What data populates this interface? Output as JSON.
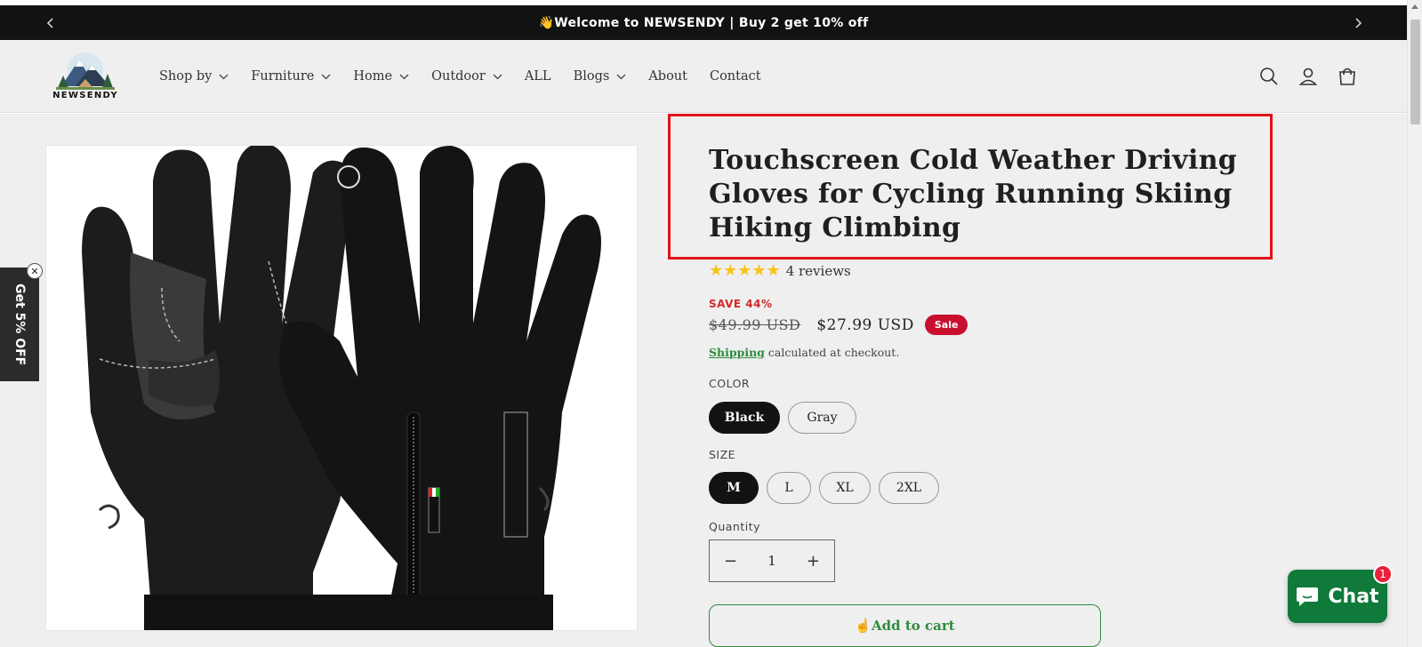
{
  "announcement": {
    "text": "👋Welcome to NEWSENDY |  Buy 2 get 10% off"
  },
  "header": {
    "brand": "NEWSENDY",
    "nav": [
      {
        "label": "Shop by",
        "dropdown": true
      },
      {
        "label": "Furniture",
        "dropdown": true
      },
      {
        "label": "Home",
        "dropdown": true
      },
      {
        "label": "Outdoor",
        "dropdown": true
      },
      {
        "label": "ALL",
        "dropdown": false
      },
      {
        "label": "Blogs",
        "dropdown": true
      },
      {
        "label": "About",
        "dropdown": false
      },
      {
        "label": "Contact",
        "dropdown": false
      }
    ],
    "icons": [
      "search-icon",
      "account-icon",
      "cart-icon"
    ]
  },
  "side_tab": {
    "label": "Get 5% OFF",
    "close": "✕"
  },
  "product": {
    "title": "Touchscreen Cold Weather Driving Gloves for Cycling Running Skiing Hiking Climbing",
    "rating_stars": 5,
    "reviews": "4 reviews",
    "save": "SAVE 44%",
    "price_old": "$49.99 USD",
    "price_new": "$27.99 USD",
    "sale_badge": "Sale",
    "shipping_link": "Shipping",
    "shipping_text": " calculated at checkout.",
    "color_label": "COLOR",
    "colors": [
      {
        "label": "Black",
        "selected": true
      },
      {
        "label": "Gray",
        "selected": false
      }
    ],
    "size_label": "SIZE",
    "sizes": [
      {
        "label": "M",
        "selected": true
      },
      {
        "label": "L",
        "selected": false
      },
      {
        "label": "XL",
        "selected": false
      },
      {
        "label": "2XL",
        "selected": false
      }
    ],
    "quantity_label": "Quantity",
    "quantity_value": "1",
    "add_to_cart": "☝Add to cart"
  },
  "chat": {
    "label": "Chat",
    "badge": "1"
  },
  "colors": {
    "accent_green": "#2e8b3e",
    "sale_red": "#c8102e",
    "highlight_red": "#e0131a",
    "star": "#f5c518"
  }
}
